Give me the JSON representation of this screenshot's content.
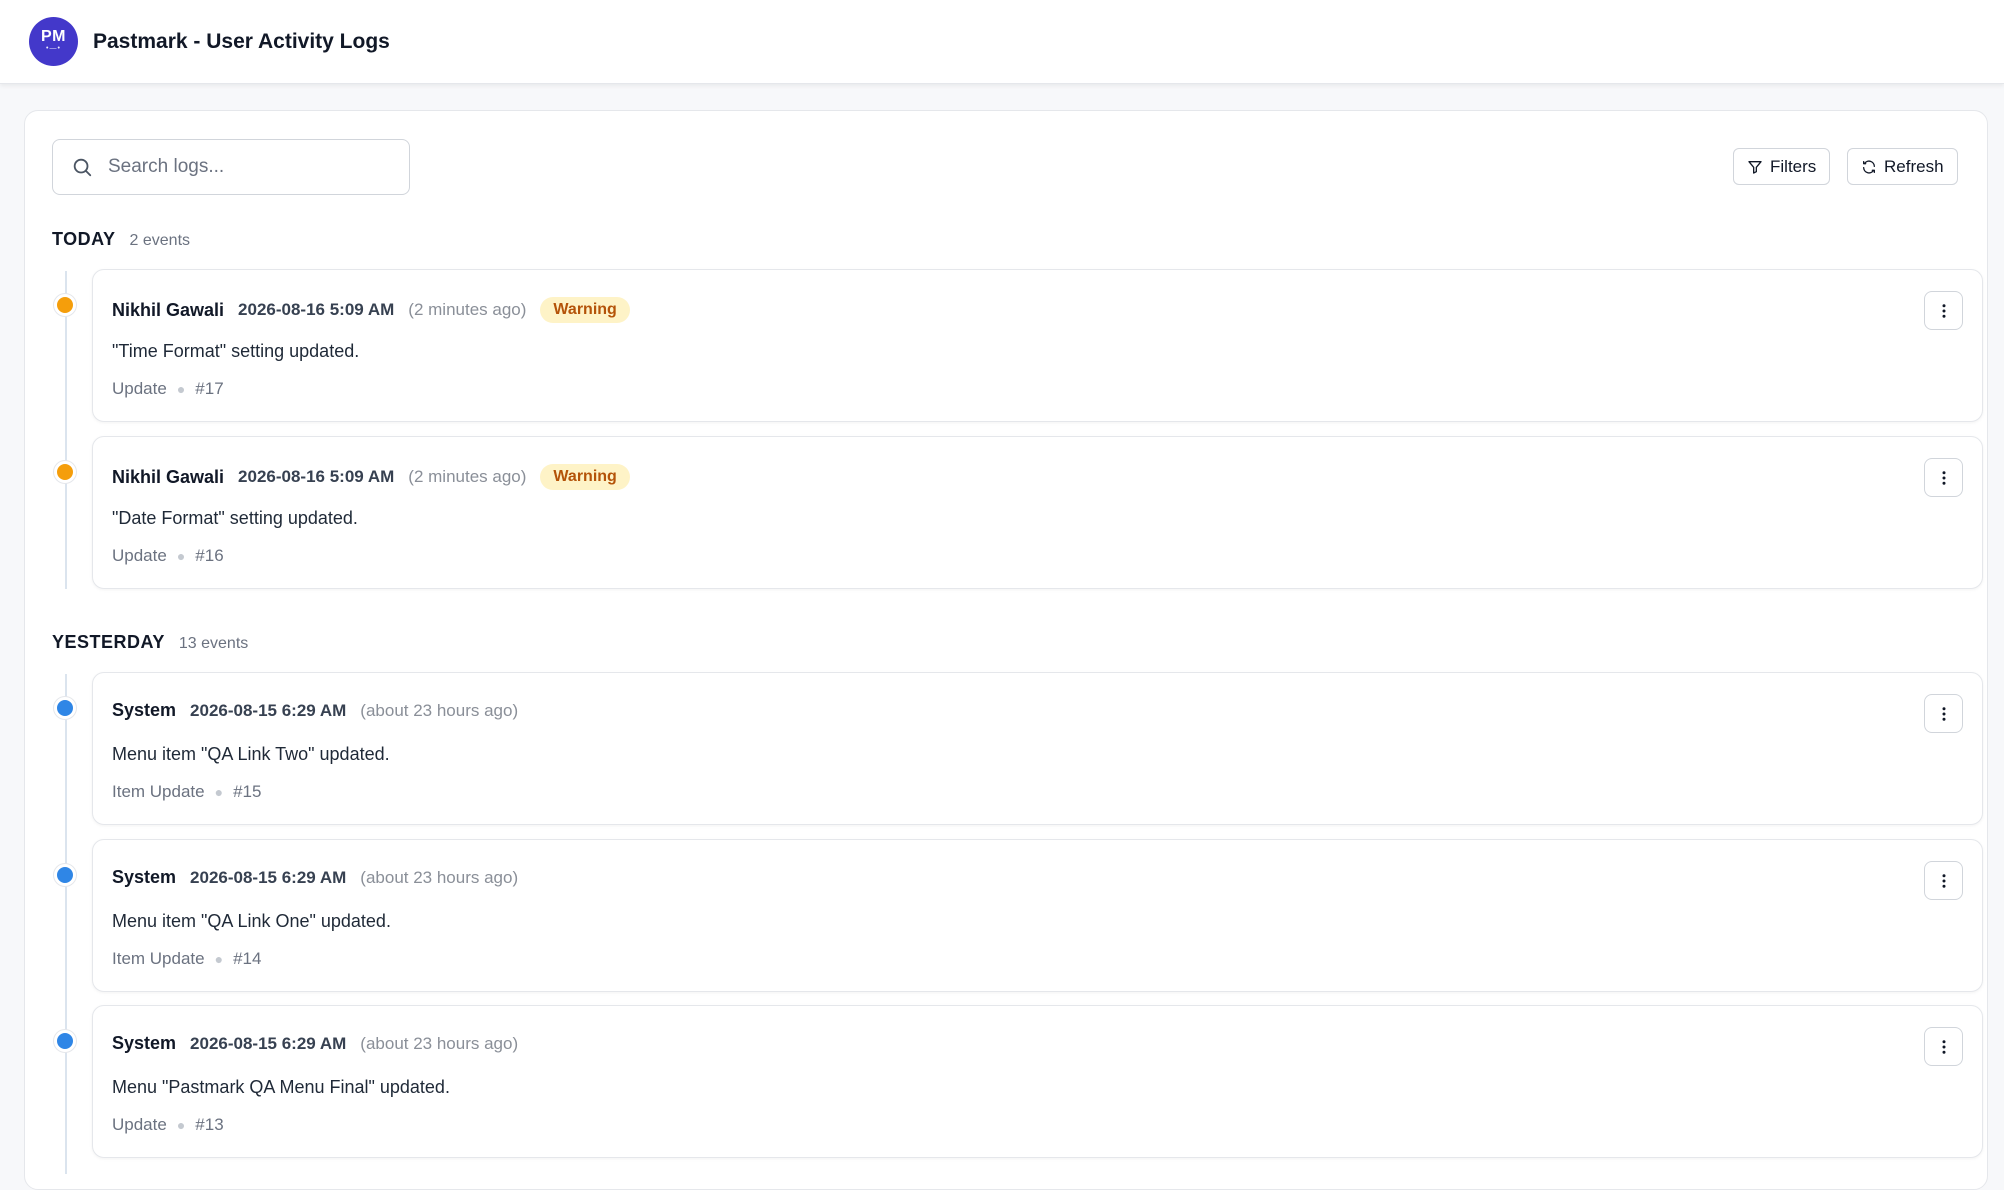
{
  "header": {
    "logo_text": "PM",
    "title": "Pastmark - User Activity Logs"
  },
  "toolbar": {
    "search_placeholder": "Search logs...",
    "filters_label": "Filters",
    "refresh_label": "Refresh"
  },
  "sections": [
    {
      "title": "TODAY",
      "count": "2 events",
      "entries": [
        {
          "user": "Nikhil Gawali",
          "timestamp": "2026-08-16 5:09 AM",
          "relative": "(2 minutes ago)",
          "badge": "Warning",
          "level": "warning",
          "message": "\"Time Format\" setting updated.",
          "type": "Update",
          "id": "#17"
        },
        {
          "user": "Nikhil Gawali",
          "timestamp": "2026-08-16 5:09 AM",
          "relative": "(2 minutes ago)",
          "badge": "Warning",
          "level": "warning",
          "message": "\"Date Format\" setting updated.",
          "type": "Update",
          "id": "#16"
        }
      ]
    },
    {
      "title": "YESTERDAY",
      "count": "13 events",
      "entries": [
        {
          "user": "System",
          "timestamp": "2026-08-15 6:29 AM",
          "relative": "(about 23 hours ago)",
          "badge": "",
          "level": "info",
          "message": "Menu item \"QA Link Two\" updated.",
          "type": "Item Update",
          "id": "#15"
        },
        {
          "user": "System",
          "timestamp": "2026-08-15 6:29 AM",
          "relative": "(about 23 hours ago)",
          "badge": "",
          "level": "info",
          "message": "Menu item \"QA Link One\" updated.",
          "type": "Item Update",
          "id": "#14"
        },
        {
          "user": "System",
          "timestamp": "2026-08-15 6:29 AM",
          "relative": "(about 23 hours ago)",
          "badge": "",
          "level": "info",
          "message": "Menu \"Pastmark QA Menu Final\" updated.",
          "type": "Update",
          "id": "#13"
        }
      ]
    }
  ],
  "colors": {
    "warning": "#f59e0b",
    "info": "#2f86e6",
    "brand": "#4338ca"
  }
}
